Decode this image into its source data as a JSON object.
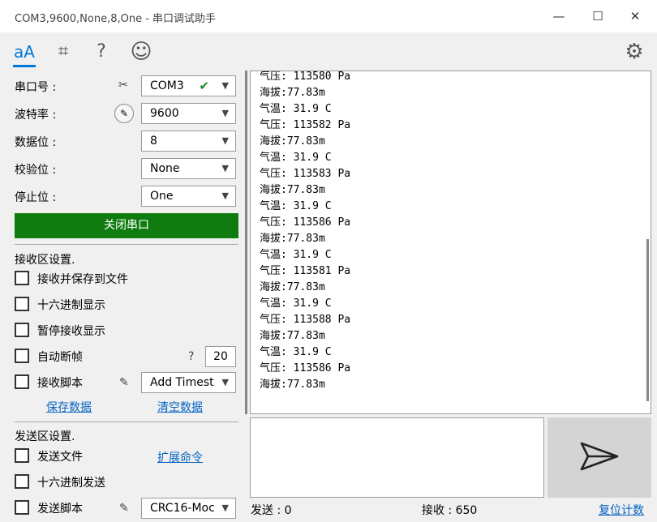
{
  "window": {
    "title": "COM3,9600,None,8,One - 串口调试助手",
    "minimize": "—",
    "maximize": "☐",
    "close": "✕"
  },
  "toolbar": {
    "font_icon": "aA",
    "crop_icon": "⌗",
    "help_icon": "?",
    "smile_icon": "☺",
    "settings_icon": "⚙"
  },
  "serial": {
    "port_label": "串口号 :",
    "port_value": "COM3",
    "baud_label": "波特率 :",
    "baud_value": "9600",
    "databits_label": "数据位 :",
    "databits_value": "8",
    "parity_label": "校验位 :",
    "parity_value": "None",
    "stopbits_label": "停止位 :",
    "stopbits_value": "One",
    "close_button": "关闭串口"
  },
  "receive_settings": {
    "title": "接收区设置.",
    "save_to_file": "接收并保存到文件",
    "hex_display": "十六进制显示",
    "pause_display": "暂停接收显示",
    "auto_frame": "自动断帧",
    "auto_frame_help": "?",
    "auto_frame_value": "20",
    "script": "接收脚本",
    "script_value": "Add Timest",
    "save_data": "保存数据",
    "clear_data": "清空数据"
  },
  "send_settings": {
    "title": "发送区设置.",
    "send_file": "发送文件",
    "ext_cmd": "扩展命令",
    "hex_send": "十六进制发送",
    "script": "发送脚本",
    "script_value": "CRC16-Moc"
  },
  "receive_text": "气压: 113580 Pa\n海拔:77.83m\n气温: 31.9 C\n气压: 113582 Pa\n海拔:77.83m\n气温: 31.9 C\n气压: 113583 Pa\n海拔:77.83m\n气温: 31.9 C\n气压: 113586 Pa\n海拔:77.83m\n气温: 31.9 C\n气压: 113581 Pa\n海拔:77.83m\n气温: 31.9 C\n气压: 113588 Pa\n海拔:77.83m\n气温: 31.9 C\n气压: 113586 Pa\n海拔:77.83m",
  "status": {
    "sent": "发送 : 0",
    "received": "接收 : 650",
    "reset": "复位计数"
  },
  "colors": {
    "accent": "#0078d7",
    "close_button": "#107c10",
    "link": "#0563c1"
  }
}
